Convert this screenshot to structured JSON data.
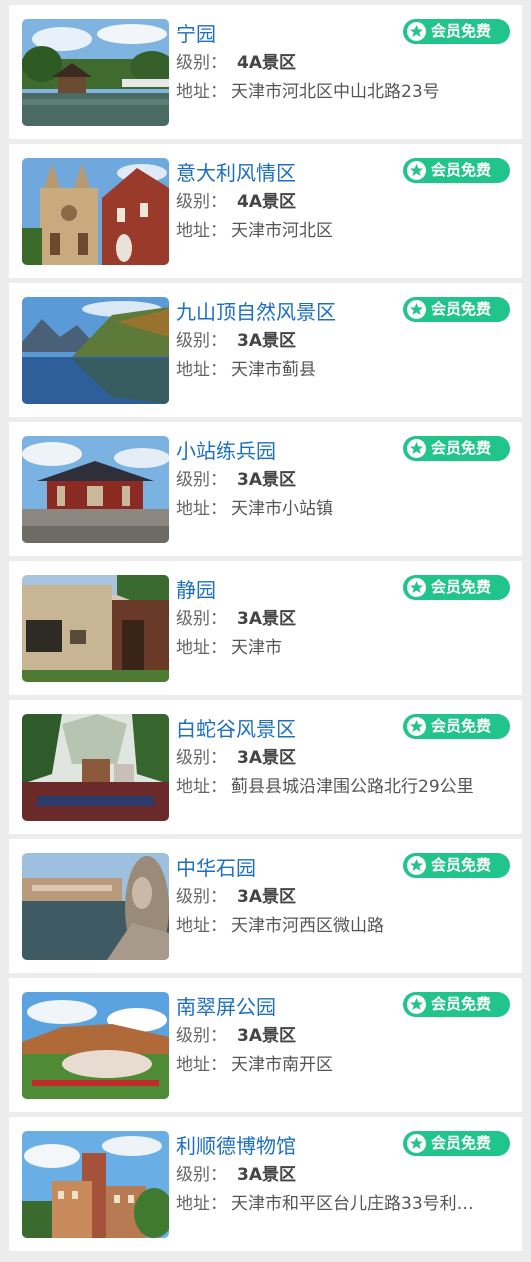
{
  "scenic_list": {
    "level_label": "级别：",
    "address_label": "地址：",
    "member_badge": "会员免费",
    "items": [
      {
        "name": "宁园",
        "level": "4A景区",
        "address": "天津市河北区中山北路23号",
        "image": "garden-pavilion-photo"
      },
      {
        "name": "意大利风情区",
        "level": "4A景区",
        "address": "天津市河北区",
        "image": "italian-church-photo"
      },
      {
        "name": "九山顶自然风景区",
        "level": "3A景区",
        "address": "天津市蓟县",
        "image": "mountain-lake-photo"
      },
      {
        "name": "小站练兵园",
        "level": "3A景区",
        "address": "天津市小站镇",
        "image": "chinese-hall-photo"
      },
      {
        "name": "静园",
        "level": "3A景区",
        "address": "天津市",
        "image": "courtyard-gate-photo"
      },
      {
        "name": "白蛇谷风景区",
        "level": "3A景区",
        "address": "蓟县县城沿津围公路北行29公里",
        "image": "valley-village-photo"
      },
      {
        "name": "中华石园",
        "level": "3A景区",
        "address": "天津市河西区微山路",
        "image": "stone-garden-photo"
      },
      {
        "name": "南翠屏公园",
        "level": "3A景区",
        "address": "天津市南开区",
        "image": "park-rock-photo"
      },
      {
        "name": "利顺德博物馆",
        "level": "3A景区",
        "address": "天津市和平区台儿庄路33号利…",
        "image": "museum-building-photo"
      }
    ]
  }
}
